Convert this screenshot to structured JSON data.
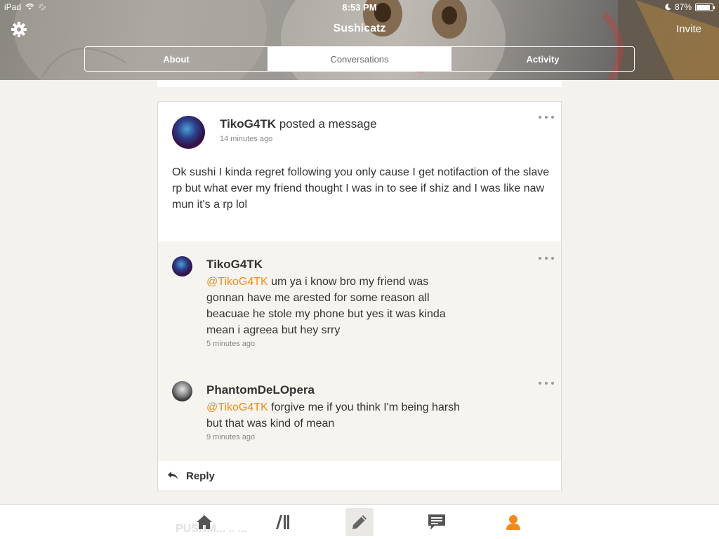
{
  "status_bar": {
    "device": "iPad",
    "time": "8:53 PM",
    "battery": "87%",
    "battery_level": 0.87
  },
  "header": {
    "title": "Sushicatz",
    "invite_label": "Invite",
    "tabs": [
      {
        "label": "About",
        "active": false
      },
      {
        "label": "Conversations",
        "active": true
      },
      {
        "label": "Activity",
        "active": false
      }
    ]
  },
  "post": {
    "author": "TikoG4TK",
    "action": "posted a message",
    "time": "14 minutes ago",
    "body": "Ok sushi I kinda regret following you only cause I get notifaction of the slave rp but what ever my friend thought I was in to see if shiz and I was like naw mun it's a rp lol"
  },
  "comments": [
    {
      "author": "TikoG4TK",
      "mention": "@TikoG4TK",
      "text_lines": [
        " um ya i know bro my friend was",
        "gonnan have  me arested for some reason all",
        "beacuae he stole my phone but yes it was kinda",
        "mean i agreea but hey srry"
      ],
      "time": "5 minutes ago"
    },
    {
      "author": "PhantomDeLOpera",
      "mention": "@TikoG4TK",
      "text_lines": [
        " forgive me if you think I'm being harsh",
        "but that was kind of mean"
      ],
      "time": "9 minutes ago"
    }
  ],
  "reply_label": "Reply",
  "tabbar": {
    "ghost_text": "PUSHM... .. ...",
    "items": [
      "home-icon",
      "library-icon",
      "compose-icon",
      "chat-icon",
      "profile-icon"
    ],
    "active_color": "#f28a1e"
  },
  "colors": {
    "accent": "#f28a1e",
    "background": "#f4f2ec"
  }
}
